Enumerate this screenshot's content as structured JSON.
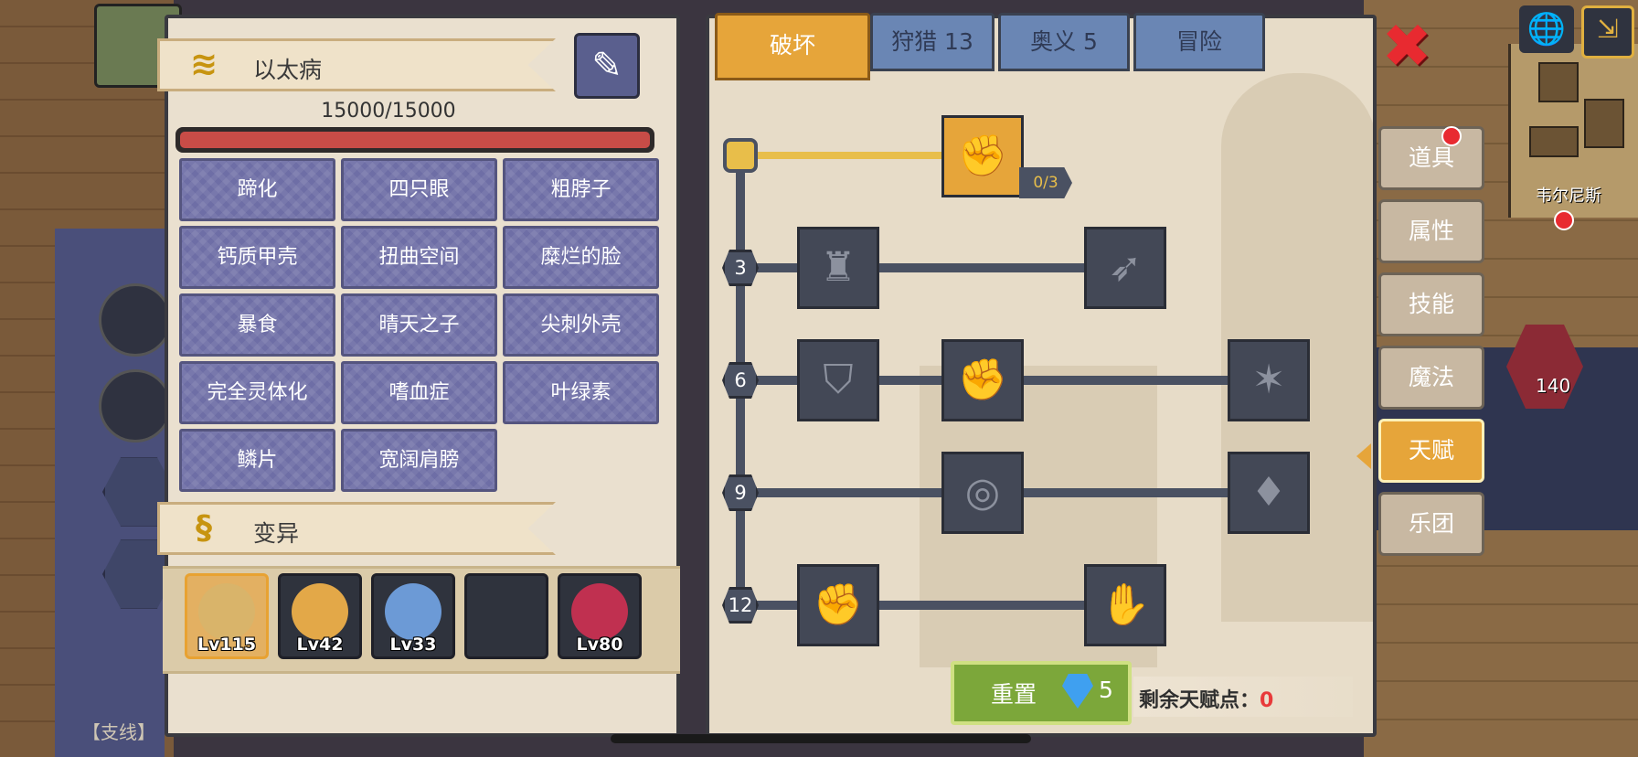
{
  "disease": {
    "name": "以太病",
    "hp": "15000/15000",
    "hp_fraction": 1.0
  },
  "traits": [
    "蹄化",
    "四只眼",
    "粗脖子",
    "钙质甲壳",
    "扭曲空间",
    "糜烂的脸",
    "暴食",
    "晴天之子",
    "尖刺外壳",
    "完全灵体化",
    "嗜血症",
    "叶绿素",
    "鳞片",
    "宽阔肩膀"
  ],
  "mutation": {
    "title": "变异",
    "pets": [
      {
        "level": "Lv115",
        "selected": true,
        "color": "#d9b46a"
      },
      {
        "level": "Lv42",
        "selected": false,
        "color": "#e3a848"
      },
      {
        "level": "Lv33",
        "selected": false,
        "color": "#6c9ad6"
      },
      {
        "level": "",
        "selected": false,
        "color": ""
      },
      {
        "level": "Lv80",
        "selected": false,
        "color": "#c03050"
      }
    ]
  },
  "tabs": [
    {
      "label": "破坏",
      "active": true
    },
    {
      "label": "狩猎 13",
      "active": false
    },
    {
      "label": "奥义 5",
      "active": false
    },
    {
      "label": "冒险",
      "active": false
    }
  ],
  "talent_tree": {
    "root_progress": "0/3",
    "row_levels": [
      "3",
      "6",
      "9",
      "12"
    ]
  },
  "reset": {
    "label": "重置",
    "cost": "5"
  },
  "remaining": {
    "label": "剩余天赋点：",
    "value": "0"
  },
  "side_menu": [
    {
      "label": "道具",
      "active": false
    },
    {
      "label": "属性",
      "active": false
    },
    {
      "label": "技能",
      "active": false
    },
    {
      "label": "魔法",
      "active": false
    },
    {
      "label": "天赋",
      "active": true
    },
    {
      "label": "乐团",
      "active": false
    }
  ],
  "world": {
    "npc_name": "韦尔尼斯",
    "potion_count": "140",
    "side_quest": "【支线】"
  },
  "colors": {
    "accent": "#e6a53a",
    "trait_bg": "#6e6ea6",
    "hp_fill": "#c84c47",
    "reset_green": "#7ca73a",
    "alert_red": "#e82a30"
  }
}
